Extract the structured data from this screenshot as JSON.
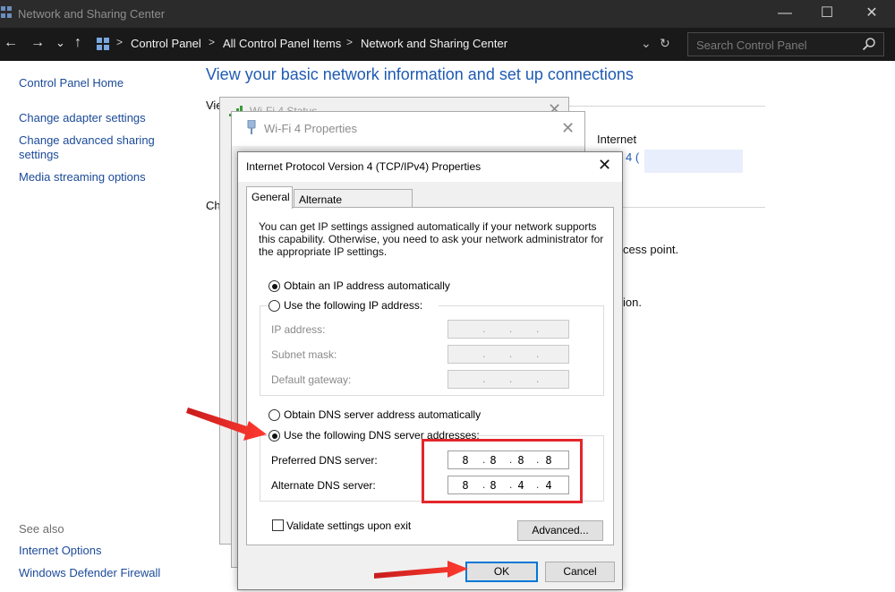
{
  "window": {
    "title": "Network and Sharing Center",
    "controls": {
      "minimize": "—",
      "maximize": "☐",
      "close": "✕"
    }
  },
  "navbar": {
    "back": "←",
    "forward": "→",
    "recent": "⌄",
    "up": "↑",
    "breadcrumbs": [
      "Control Panel",
      "All Control Panel Items",
      "Network and Sharing Center"
    ],
    "separator": ">",
    "dropdown": "⌄",
    "refresh": "↻",
    "search_placeholder": "Search Control Panel"
  },
  "left_pane": {
    "links": [
      "Control Panel Home",
      "Change adapter settings",
      "Change advanced sharing settings",
      "Media streaming options"
    ],
    "see_also_heading": "See also",
    "see_also_links": [
      "Internet Options",
      "Windows Defender Firewall"
    ]
  },
  "main": {
    "title": "View your basic network information and set up connections",
    "frag_view": "Vie",
    "frag_change": "Ch",
    "internet_label": "Internet",
    "connection_frag": "4 (",
    "access_point_frag": "cess point.",
    "ion_frag": "ion."
  },
  "dialogs": {
    "wifi_status_title": "Wi-Fi 4 Status",
    "wifi_props_title": "Wi-Fi 4 Properties",
    "close": "✕"
  },
  "ipv4": {
    "title": "Internet Protocol Version 4 (TCP/IPv4) Properties",
    "close": "✕",
    "tabs": [
      "General",
      "Alternate Configuration"
    ],
    "description": "You can get IP settings assigned automatically if your network supports this capability. Otherwise, you need to ask your network administrator for the appropriate IP settings.",
    "ip_auto": "Obtain an IP address automatically",
    "ip_manual": "Use the following IP address:",
    "ip_address_label": "IP address:",
    "subnet_label": "Subnet mask:",
    "gateway_label": "Default gateway:",
    "dns_auto": "Obtain DNS server address automatically",
    "dns_manual": "Use the following DNS server addresses:",
    "preferred_dns_label": "Preferred DNS server:",
    "alternate_dns_label": "Alternate DNS server:",
    "preferred_dns": [
      "8",
      "8",
      "8",
      "8"
    ],
    "alternate_dns": [
      "8",
      "8",
      "4",
      "4"
    ],
    "validate_label": "Validate settings upon exit",
    "advanced_button": "Advanced...",
    "ok_button": "OK",
    "cancel_button": "Cancel",
    "ip_auto_selected": true,
    "dns_manual_selected": true,
    "validate_checked": false
  },
  "colors": {
    "link": "#1b4a99",
    "title_blue": "#1f5bb3",
    "annotation_red": "#e3262b",
    "default_button_border": "#0078d7"
  }
}
